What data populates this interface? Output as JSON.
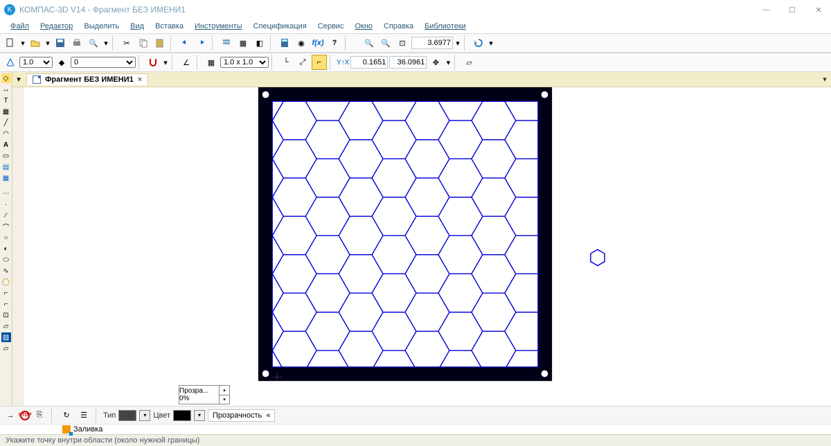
{
  "title": "КОМПАС-3D V14 - Фрагмент БЕЗ ИМЕНИ1",
  "menus": [
    "Файл",
    "Редактор",
    "Выделить",
    "Вид",
    "Вставка",
    "Инструменты",
    "Спецификация",
    "Сервис",
    "Окно",
    "Справка",
    "Библиотеки"
  ],
  "tab": {
    "label": "Фрагмент БЕЗ ИМЕНИ1"
  },
  "toolbar1": {
    "zoomval": "3.6977"
  },
  "toolbar2": {
    "step": "1.0",
    "layer": "0",
    "grid": "1.0 x 1.0",
    "yx_label": "Y↑X",
    "coord_x": "0.1651",
    "coord_y": "36.0961"
  },
  "prop": {
    "type_lbl": "Тип",
    "color_lbl": "Цвет",
    "trans_btn": "Прозрачность",
    "tab_lbl": "Заливка",
    "trans_box": "Прозра... 0%"
  },
  "status": "Укажите точку внутри области (около нужной границы)"
}
